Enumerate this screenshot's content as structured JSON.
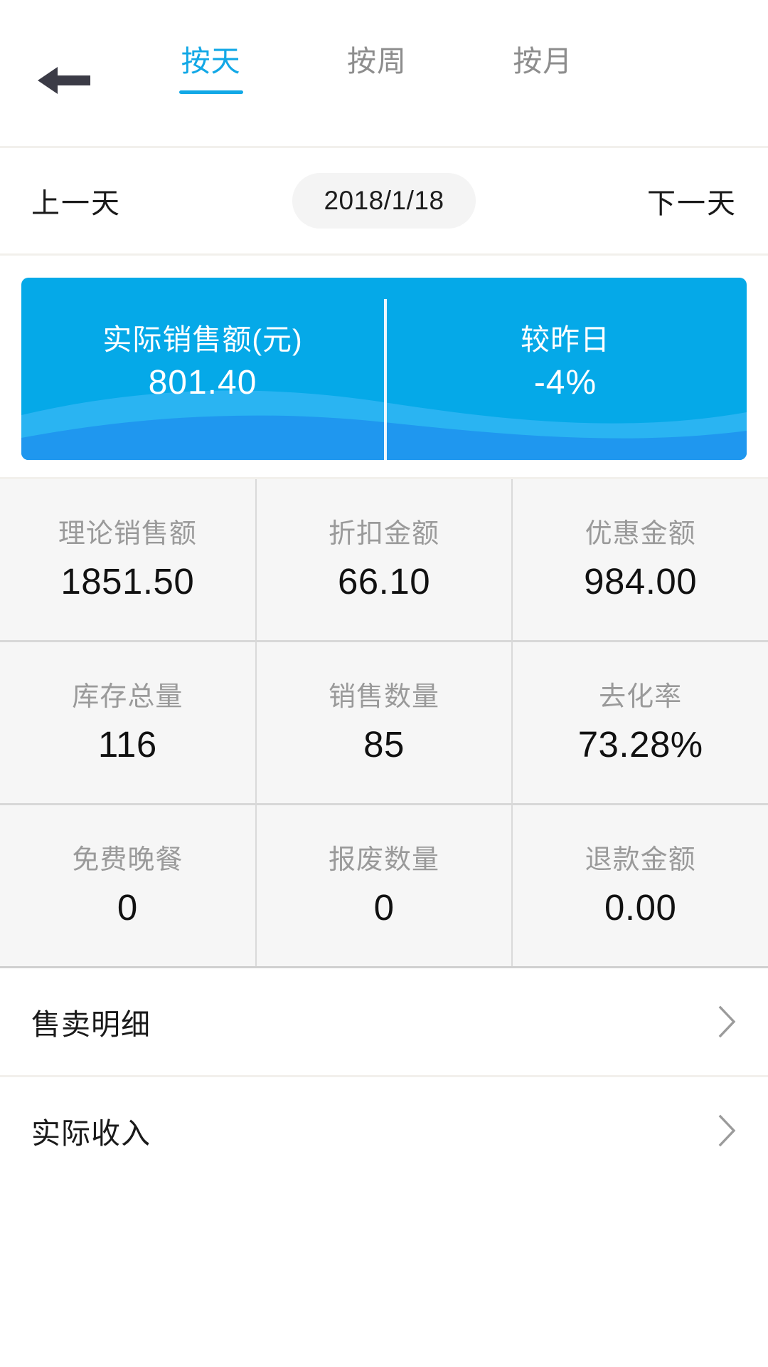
{
  "header": {
    "back_icon": "arrow-left-icon",
    "tabs": [
      {
        "label": "按天",
        "active": true
      },
      {
        "label": "按周",
        "active": false
      },
      {
        "label": "按月",
        "active": false
      }
    ]
  },
  "date_selector": {
    "prev_label": "上一天",
    "current_date": "2018/1/18",
    "next_label": "下一天"
  },
  "summary_card": {
    "sales_label": "实际销售额(元)",
    "sales_value": "801.40",
    "compare_label": "较昨日",
    "compare_value": "-4%",
    "background_color": "#05a9e8",
    "wave_color_light": "#2ab4f2",
    "wave_color_deep": "#1f97ef"
  },
  "stats": {
    "rows": [
      [
        {
          "label": "理论销售额",
          "value": "1851.50"
        },
        {
          "label": "折扣金额",
          "value": "66.10"
        },
        {
          "label": "优惠金额",
          "value": "984.00"
        }
      ],
      [
        {
          "label": "库存总量",
          "value": "116"
        },
        {
          "label": "销售数量",
          "value": "85"
        },
        {
          "label": "去化率",
          "value": "73.28%"
        }
      ],
      [
        {
          "label": "免费晚餐",
          "value": "0"
        },
        {
          "label": "报废数量",
          "value": "0"
        },
        {
          "label": "退款金额",
          "value": "0.00"
        }
      ]
    ]
  },
  "list": {
    "items": [
      {
        "label": "售卖明细",
        "icon": "chevron-right-icon"
      },
      {
        "label": "实际收入",
        "icon": "chevron-right-icon"
      }
    ]
  },
  "theme": {
    "accent": "#12a8e6",
    "text_primary": "#1a1a1a",
    "text_muted": "#9a9a9a",
    "grid_bg": "#f6f6f6"
  }
}
